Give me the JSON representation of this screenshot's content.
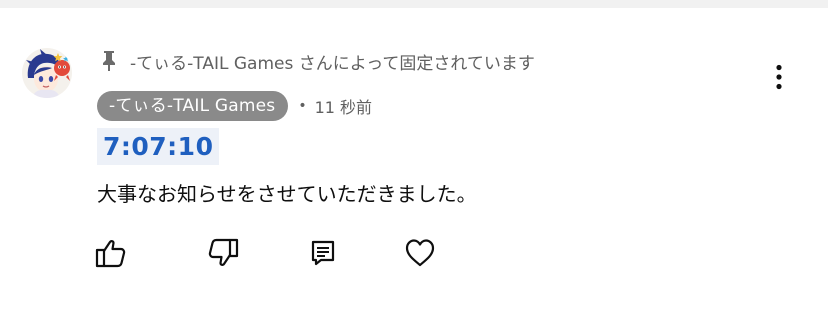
{
  "pinned": {
    "text": "-てぃる-TAIL Games さんによって固定されています",
    "icon": "pin-icon"
  },
  "comment": {
    "author": "-てぃる-TAIL Games",
    "separator": "•",
    "time_ago": "11 秒前",
    "timestamp_link": "7:07:10",
    "body": "大事なお知らせをさせていただきました。"
  },
  "actions": {
    "like_icon": "thumbs-up-icon",
    "dislike_icon": "thumbs-down-icon",
    "reply_icon": "reply-icon",
    "heart_icon": "heart-icon",
    "more_icon": "more-vertical-icon"
  },
  "colors": {
    "author_chip_bg": "#8a8a8a",
    "timestamp_link": "#1f5fbf",
    "timestamp_bg": "#edf1f8",
    "meta_text": "#606060",
    "body_text": "#0f0f0f"
  }
}
